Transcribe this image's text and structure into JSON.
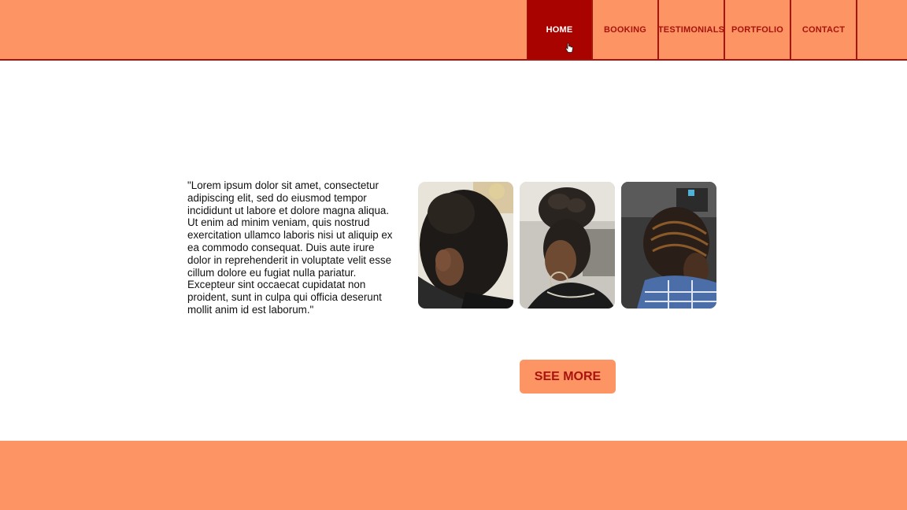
{
  "nav": {
    "items": [
      {
        "label": "HOME",
        "active": true
      },
      {
        "label": "BOOKING",
        "active": false
      },
      {
        "label": "TESTIMONIALS",
        "active": false
      },
      {
        "label": "PORTFOLIO",
        "active": false
      },
      {
        "label": "CONTACT",
        "active": false
      }
    ]
  },
  "testimonial": {
    "text": "\"Lorem ipsum dolor sit amet, consectetur adipiscing elit, sed do eiusmod tempor incididunt ut labore et dolore magna aliqua. Ut enim ad minim veniam, quis nostrud exercitation ullamco laboris nisi ut aliquip ex ea commodo consequat. Duis aute irure dolor in reprehenderit in voluptate velit esse cillum dolore eu fugiat nulla pariatur. Excepteur sint occaecat cupidatat non proident, sunt in culpa qui officia deserunt mollit anim id est laborum.\""
  },
  "gallery": {
    "photos": [
      "natural-hair-photo",
      "updo-braids-photo",
      "locs-style-photo"
    ]
  },
  "actions": {
    "see_more_label": "SEE MORE"
  },
  "colors": {
    "accent": "#fd9463",
    "brand": "#a8130e",
    "active_tab": "#a90300"
  }
}
